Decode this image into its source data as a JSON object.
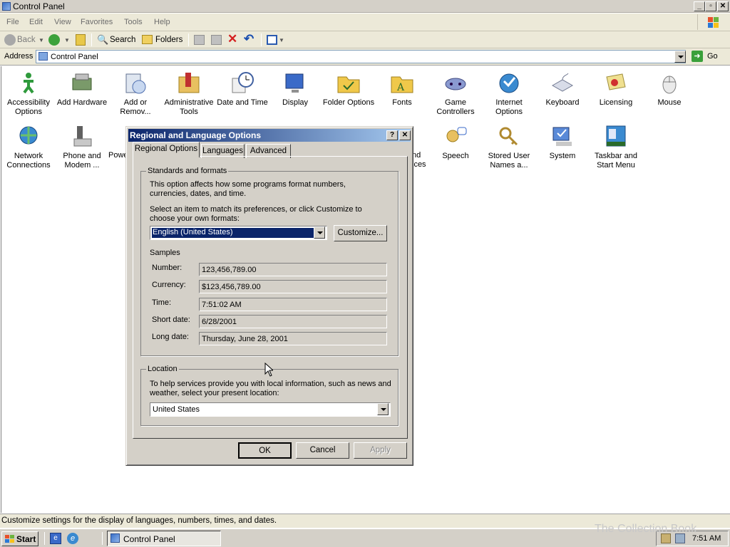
{
  "window": {
    "title": "Control Panel"
  },
  "menu": [
    "File",
    "Edit",
    "View",
    "Favorites",
    "Tools",
    "Help"
  ],
  "toolbar": {
    "back": "Back",
    "search": "Search",
    "folders": "Folders"
  },
  "address": {
    "label": "Address",
    "value": "Control Panel",
    "go": "Go"
  },
  "items": [
    {
      "label": "Accessibility Options",
      "icon": "accessibility-icon"
    },
    {
      "label": "Add Hardware",
      "icon": "add-hardware-icon"
    },
    {
      "label": "Add or Remov...",
      "icon": "add-remove-programs-icon"
    },
    {
      "label": "Administrative Tools",
      "icon": "administrative-tools-icon"
    },
    {
      "label": "Date and Time",
      "icon": "date-time-icon"
    },
    {
      "label": "Display",
      "icon": "display-icon"
    },
    {
      "label": "Folder Options",
      "icon": "folder-options-icon"
    },
    {
      "label": "Fonts",
      "icon": "fonts-icon"
    },
    {
      "label": "Game Controllers",
      "icon": "game-controllers-icon"
    },
    {
      "label": "Internet Options",
      "icon": "internet-options-icon"
    },
    {
      "label": "Keyboard",
      "icon": "keyboard-icon"
    },
    {
      "label": "Licensing",
      "icon": "licensing-icon"
    },
    {
      "label": "Mouse",
      "icon": "mouse-icon"
    },
    {
      "label": "Network Connections",
      "icon": "network-connections-icon"
    },
    {
      "label": "Phone and Modem ...",
      "icon": "phone-modem-icon"
    },
    {
      "label": "Powe",
      "icon": "power-options-icon"
    },
    {
      "label": "nd",
      "icon": "sounds-icon"
    },
    {
      "label": "Speech",
      "icon": "speech-icon"
    },
    {
      "label": "Stored User Names a...",
      "icon": "stored-user-names-icon"
    },
    {
      "label": "System",
      "icon": "system-icon"
    },
    {
      "label": "Taskbar and Start Menu",
      "icon": "taskbar-start-menu-icon"
    }
  ],
  "partial_label_ices": "ices",
  "dialog": {
    "title": "Regional and Language Options",
    "help": "?",
    "close": "✕",
    "tabs": [
      "Regional Options",
      "Languages",
      "Advanced"
    ],
    "standards": {
      "legend": "Standards and formats",
      "desc": "This option affects how some programs format numbers, currencies, dates, and time.",
      "select_text": "Select an item to match its preferences, or click Customize to choose your own formats:",
      "selected": "English (United States)",
      "customize": "Customize...",
      "samples_label": "Samples",
      "samples": [
        {
          "label": "Number:",
          "value": "123,456,789.00"
        },
        {
          "label": "Currency:",
          "value": "$123,456,789.00"
        },
        {
          "label": "Time:",
          "value": "7:51:02 AM"
        },
        {
          "label": "Short date:",
          "value": "6/28/2001"
        },
        {
          "label": "Long date:",
          "value": "Thursday, June 28, 2001"
        }
      ]
    },
    "location": {
      "legend": "Location",
      "desc": "To help services provide you with local information, such as news and weather, select your present location:",
      "selected": "United States"
    },
    "buttons": {
      "ok": "OK",
      "cancel": "Cancel",
      "apply": "Apply"
    }
  },
  "status": "Customize settings for the display of languages, numbers, times, and dates.",
  "taskbar": {
    "start": "Start",
    "app": "Control Panel",
    "clock": "7:51 AM"
  },
  "watermark": "The Collection Book"
}
